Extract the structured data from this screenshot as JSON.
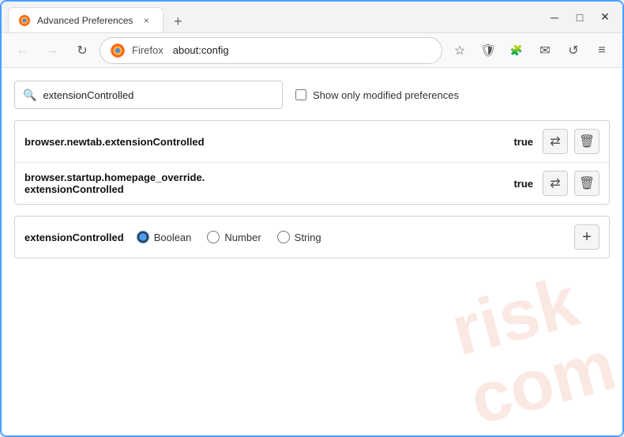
{
  "window": {
    "title": "Advanced Preferences",
    "tab_close_label": "×",
    "new_tab_label": "+",
    "minimize_label": "─",
    "maximize_label": "□",
    "close_label": "✕"
  },
  "nav": {
    "back_title": "Back",
    "forward_title": "Forward",
    "reload_title": "Reload",
    "browser_label": "Firefox",
    "address": "about:config",
    "bookmark_title": "Bookmark",
    "shield_title": "Shield",
    "extension_title": "Extension",
    "mail_title": "Mail",
    "sync_title": "Sync",
    "menu_title": "Menu"
  },
  "search": {
    "placeholder": "extensionControlled",
    "value": "extensionControlled",
    "checkbox_label": "Show only modified preferences",
    "checkbox_checked": false
  },
  "preferences": [
    {
      "name": "browser.newtab.extensionControlled",
      "value": "true",
      "toggle_title": "Toggle",
      "delete_title": "Delete"
    },
    {
      "name": "browser.startup.homepage_override.\nextensionControlled",
      "name_line1": "browser.startup.homepage_override.",
      "name_line2": "extensionControlled",
      "value": "true",
      "toggle_title": "Toggle",
      "delete_title": "Delete"
    }
  ],
  "new_pref": {
    "name": "extensionControlled",
    "types": [
      {
        "id": "boolean",
        "label": "Boolean",
        "checked": true
      },
      {
        "id": "number",
        "label": "Number",
        "checked": false
      },
      {
        "id": "string",
        "label": "String",
        "checked": false
      }
    ],
    "add_title": "+"
  },
  "watermark": {
    "line1": "risk",
    "line2": "com"
  },
  "icons": {
    "search": "🔍",
    "back": "←",
    "forward": "→",
    "reload": "↻",
    "bookmark": "☆",
    "shield": "🛡",
    "extension": "🧩",
    "mail": "✉",
    "sync": "↺",
    "menu": "≡",
    "toggle": "⇄",
    "delete": "🗑"
  }
}
